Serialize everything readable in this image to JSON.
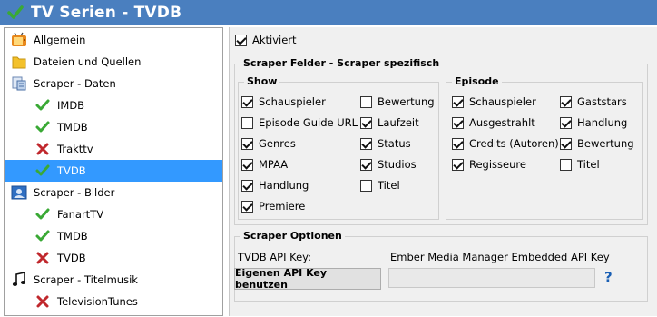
{
  "window": {
    "title": "TV Serien - TVDB"
  },
  "tree": {
    "items": [
      {
        "label": "Allgemein",
        "icon": "tv-icon"
      },
      {
        "label": "Dateien und Quellen",
        "icon": "folder-icon"
      },
      {
        "label": "Scraper - Daten",
        "icon": "data-scraper-icon"
      },
      {
        "label": "IMDB",
        "icon": "check-icon"
      },
      {
        "label": "TMDB",
        "icon": "check-icon"
      },
      {
        "label": "Trakttv",
        "icon": "cross-icon"
      },
      {
        "label": "TVDB",
        "icon": "check-icon",
        "selected": true
      },
      {
        "label": "Scraper - Bilder",
        "icon": "image-scraper-icon"
      },
      {
        "label": "FanartTV",
        "icon": "check-icon"
      },
      {
        "label": "TMDB",
        "icon": "check-icon"
      },
      {
        "label": "TVDB",
        "icon": "cross-icon"
      },
      {
        "label": "Scraper - Titelmusik",
        "icon": "music-note-icon"
      },
      {
        "label": "TelevisionTunes",
        "icon": "cross-icon"
      }
    ]
  },
  "settings": {
    "aktiviert": {
      "label": "Aktiviert",
      "checked": true
    },
    "scraper_fields": {
      "title": "Scraper Felder - Scraper spezifisch",
      "show": {
        "title": "Show",
        "col1": [
          {
            "label": "Schauspieler",
            "checked": true
          },
          {
            "label": "Episode Guide URL",
            "checked": false
          },
          {
            "label": "Genres",
            "checked": true
          },
          {
            "label": "MPAA",
            "checked": true
          },
          {
            "label": "Handlung",
            "checked": true
          },
          {
            "label": "Premiere",
            "checked": true
          }
        ],
        "col2": [
          {
            "label": "Bewertung",
            "checked": false
          },
          {
            "label": "Laufzeit",
            "checked": true
          },
          {
            "label": "Status",
            "checked": true
          },
          {
            "label": "Studios",
            "checked": true
          },
          {
            "label": "Titel",
            "checked": false
          }
        ]
      },
      "episode": {
        "title": "Episode",
        "col1": [
          {
            "label": "Schauspieler",
            "checked": true
          },
          {
            "label": "Ausgestrahlt",
            "checked": true
          },
          {
            "label": "Credits (Autoren)",
            "checked": true
          },
          {
            "label": "Regisseure",
            "checked": true
          }
        ],
        "col2": [
          {
            "label": "Gaststars",
            "checked": true
          },
          {
            "label": "Handlung",
            "checked": true
          },
          {
            "label": "Bewertung",
            "checked": true
          },
          {
            "label": "Titel",
            "checked": false
          }
        ]
      }
    },
    "scraper_options": {
      "title": "Scraper Optionen",
      "api_key_label": "TVDB API Key:",
      "api_key_value": "Ember Media Manager Embedded API Key",
      "own_key_button": "Eigenen API Key benutzen",
      "own_key_input": "",
      "help_glyph": "?"
    }
  },
  "colors": {
    "titlebar": "#4a7fbf",
    "selection": "#3399ff",
    "check_green": "#3aa935",
    "cross_red": "#c0282d"
  }
}
